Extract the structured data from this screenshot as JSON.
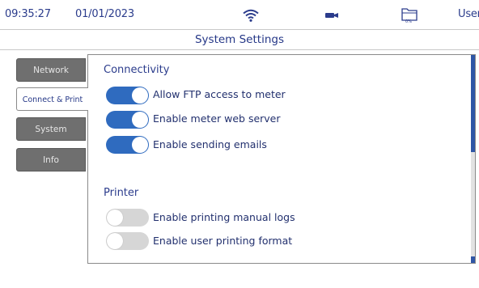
{
  "status_bar": {
    "time": "09:35:27",
    "date": "01/01/2023",
    "user": "User",
    "icons": [
      "wifi-icon",
      "camera-icon",
      "folder-icon"
    ],
    "storage_text": "0%"
  },
  "header": {
    "title": "System Settings"
  },
  "tabs": [
    {
      "label": "Network",
      "active": false
    },
    {
      "label": "Connect & Print",
      "active": true
    },
    {
      "label": "System",
      "active": false
    },
    {
      "label": "Info",
      "active": false
    }
  ],
  "connectivity": {
    "title": "Connectivity",
    "options": [
      {
        "label": "Allow FTP access to meter",
        "enabled": true
      },
      {
        "label": "Enable meter web server",
        "enabled": true
      },
      {
        "label": "Enable sending emails",
        "enabled": true
      }
    ]
  },
  "printer": {
    "title": "Printer",
    "options": [
      {
        "label": "Enable printing manual logs",
        "enabled": false
      },
      {
        "label": "Enable user printing format",
        "enabled": false
      }
    ]
  },
  "colors": {
    "accent": "#2f6bbf",
    "tab_inactive": "#6f6f6f",
    "text": "#253787"
  }
}
